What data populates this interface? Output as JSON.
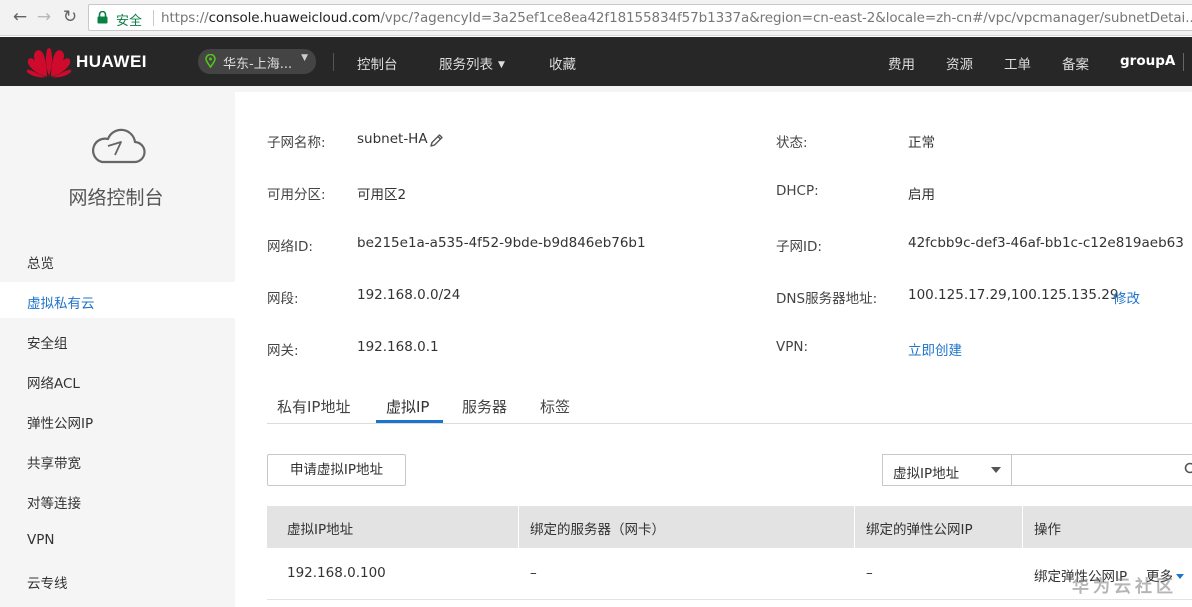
{
  "browser": {
    "secure_label": "安全",
    "url_scheme": "https://",
    "url_host": "console.huaweicloud.com",
    "url_path": "/vpc/?agencyId=3a25ef1ce8ea42f18155834f57b1337a&region=cn-east-2&locale=zh-cn#/vpc/vpcmanager/subnetDetai..."
  },
  "topnav": {
    "logo_text": "HUAWEI",
    "region": "华东-上海...",
    "console": "控制台",
    "service_list": "服务列表",
    "favorites": "收藏",
    "right_items": [
      "费用",
      "资源",
      "工单",
      "备案"
    ],
    "user": "groupA"
  },
  "sidebar": {
    "title": "网络控制台",
    "items": [
      {
        "label": "总览",
        "active": false
      },
      {
        "label": "虚拟私有云",
        "active": true
      },
      {
        "label": "安全组",
        "active": false
      },
      {
        "label": "网络ACL",
        "active": false
      },
      {
        "label": "弹性公网IP",
        "active": false
      },
      {
        "label": "共享带宽",
        "active": false
      },
      {
        "label": "对等连接",
        "active": false
      },
      {
        "label": "VPN",
        "active": false
      },
      {
        "label": "云专线",
        "active": false
      }
    ]
  },
  "details": {
    "subnet_name_label": "子网名称:",
    "subnet_name": "subnet-HA",
    "az_label": "可用分区:",
    "az": "可用区2",
    "network_id_label": "网络ID:",
    "network_id": "be215e1a-a535-4f52-9bde-b9d846eb76b1",
    "cidr_label": "网段:",
    "cidr": "192.168.0.0/24",
    "gateway_label": "网关:",
    "gateway": "192.168.0.1",
    "status_label": "状态:",
    "status": "正常",
    "dhcp_label": "DHCP:",
    "dhcp": "启用",
    "subnet_id_label": "子网ID:",
    "subnet_id": "42fcbb9c-def3-46af-bb1c-c12e819aeb63",
    "dns_label": "DNS服务器地址:",
    "dns": "100.125.17.29,100.125.135.29",
    "dns_edit": "修改",
    "vpn_label": "VPN:",
    "vpn_action": "立即创建"
  },
  "tabs": [
    "私有IP地址",
    "虚拟IP",
    "服务器",
    "标签"
  ],
  "active_tab": "虚拟IP",
  "toolbar": {
    "apply_button": "申请虚拟IP地址",
    "filter_select": "虚拟IP地址",
    "search_value": ""
  },
  "table": {
    "headers": [
      "虚拟IP地址",
      "绑定的服务器（网卡）",
      "绑定的弹性公网IP",
      "操作"
    ],
    "rows": [
      {
        "vip": "192.168.0.100",
        "server": "–",
        "eip": "–",
        "action_bind": "绑定弹性公网IP",
        "action_more": "更多"
      }
    ]
  },
  "watermark": "华为云社区",
  "colors": {
    "accent": "#1e74cc",
    "topnav_bg": "#272727",
    "secure_green": "#0b8043",
    "huawei_red": "#cf0a2c"
  }
}
